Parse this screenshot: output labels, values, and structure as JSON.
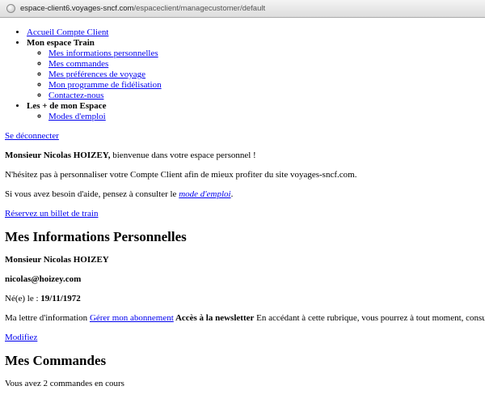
{
  "browser": {
    "url_domain": "espace-client6.voyages-sncf.com",
    "url_path": "/espaceclient/managecustomer/default"
  },
  "menu": {
    "item1": "Accueil Compte Client",
    "section_train": "Mon espace Train",
    "train_items": [
      "Mes informations personnelles",
      "Mes commandes",
      "Mes préférences de voyage",
      "Mon programme de fidélisation",
      "Contactez-nous"
    ],
    "section_plus": "Les + de mon Espace",
    "plus_items": [
      "Modes d'emploi"
    ]
  },
  "logout_link": "Se déconnecter",
  "welcome": {
    "name": "Monsieur Nicolas HOIZEY,",
    "text": " bienvenue dans votre espace personnel !"
  },
  "personalize_text": "N'hésitez pas à personnaliser votre Compte Client afin de mieux profiter du site voyages-sncf.com.",
  "help": {
    "before": "Si vous avez besoin d'aide, pensez à consulter le ",
    "link": "mode d'emploi",
    "after": "."
  },
  "book_link": "Réservez un billet de train",
  "personal_info": {
    "heading": "Mes Informations Personnelles",
    "name": "Monsieur Nicolas HOIZEY",
    "email": "nicolas@hoizey.com",
    "birth_label": "Né(e) le : ",
    "birth_date": "19/11/1972",
    "newsletter_before": "Ma lettre d'information ",
    "newsletter_link": "Gérer mon abonnement",
    "newsletter_bold": " Accès à la newsletter",
    "newsletter_text": " En accédant à cette rubrique, vous pourrez à tout moment, consul",
    "modify_link": "Modifiez"
  },
  "orders": {
    "heading": "Mes Commandes",
    "text": "Vous avez 2 commandes en cours"
  }
}
